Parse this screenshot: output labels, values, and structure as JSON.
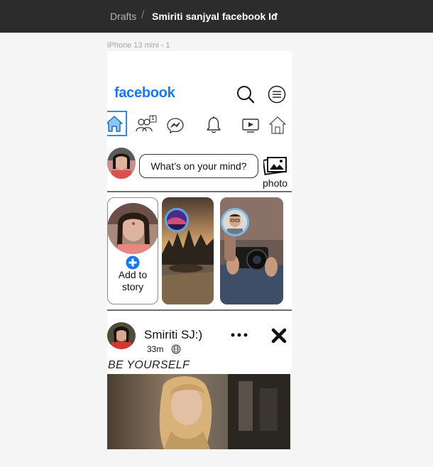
{
  "breadcrumb": {
    "drafts": "Drafts",
    "separator": "/",
    "file_name": "Smiriti sanjyal facebook Id"
  },
  "frame_label": "iPhone 13 mini - 1",
  "app": {
    "logo": "facebook",
    "brand_color": "#1877f2"
  },
  "nav": {
    "friends_badge": "1",
    "icons": [
      "home-icon",
      "friends-icon",
      "messenger-icon",
      "bell-icon",
      "video-icon",
      "marketplace-icon"
    ]
  },
  "composer": {
    "placeholder": "What’s on your mind?",
    "photo_label": "photo"
  },
  "stories": {
    "add_label_line1": "Add to",
    "add_label_line2": "story"
  },
  "post": {
    "author": "Smiriti SJ:)",
    "time": "33m",
    "caption": "BE YOURSELF"
  }
}
